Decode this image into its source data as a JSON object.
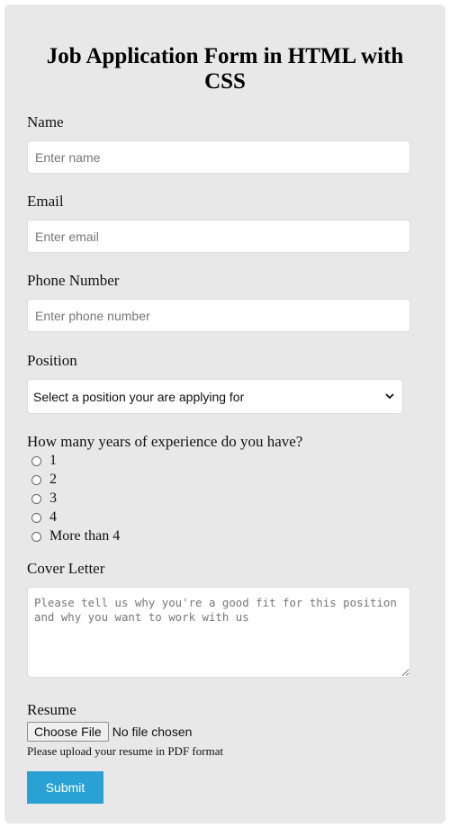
{
  "form": {
    "title": "Job Application Form in HTML with CSS",
    "name": {
      "label": "Name",
      "placeholder": "Enter name",
      "value": ""
    },
    "email": {
      "label": "Email",
      "placeholder": "Enter email",
      "value": ""
    },
    "phone": {
      "label": "Phone Number",
      "placeholder": "Enter phone number",
      "value": ""
    },
    "position": {
      "label": "Position",
      "selected": "Select a position your are applying for",
      "icon": "chevron-down-icon"
    },
    "experience": {
      "question": "How many years of experience do you have?",
      "options": [
        {
          "label": "1",
          "checked": false
        },
        {
          "label": "2",
          "checked": false
        },
        {
          "label": "3",
          "checked": false
        },
        {
          "label": "4",
          "checked": false
        },
        {
          "label": "More than 4",
          "checked": false
        }
      ]
    },
    "cover_letter": {
      "label": "Cover Letter",
      "placeholder": "Please tell us why you're a good fit for this position and why you want to work with us",
      "value": ""
    },
    "resume": {
      "label": "Resume",
      "button_label": "Choose File",
      "status": "No file chosen",
      "hint": "Please upload your resume in PDF format"
    },
    "submit_label": "Submit",
    "colors": {
      "background": "#e8e8e8",
      "submit": "#2aa1d4"
    }
  }
}
